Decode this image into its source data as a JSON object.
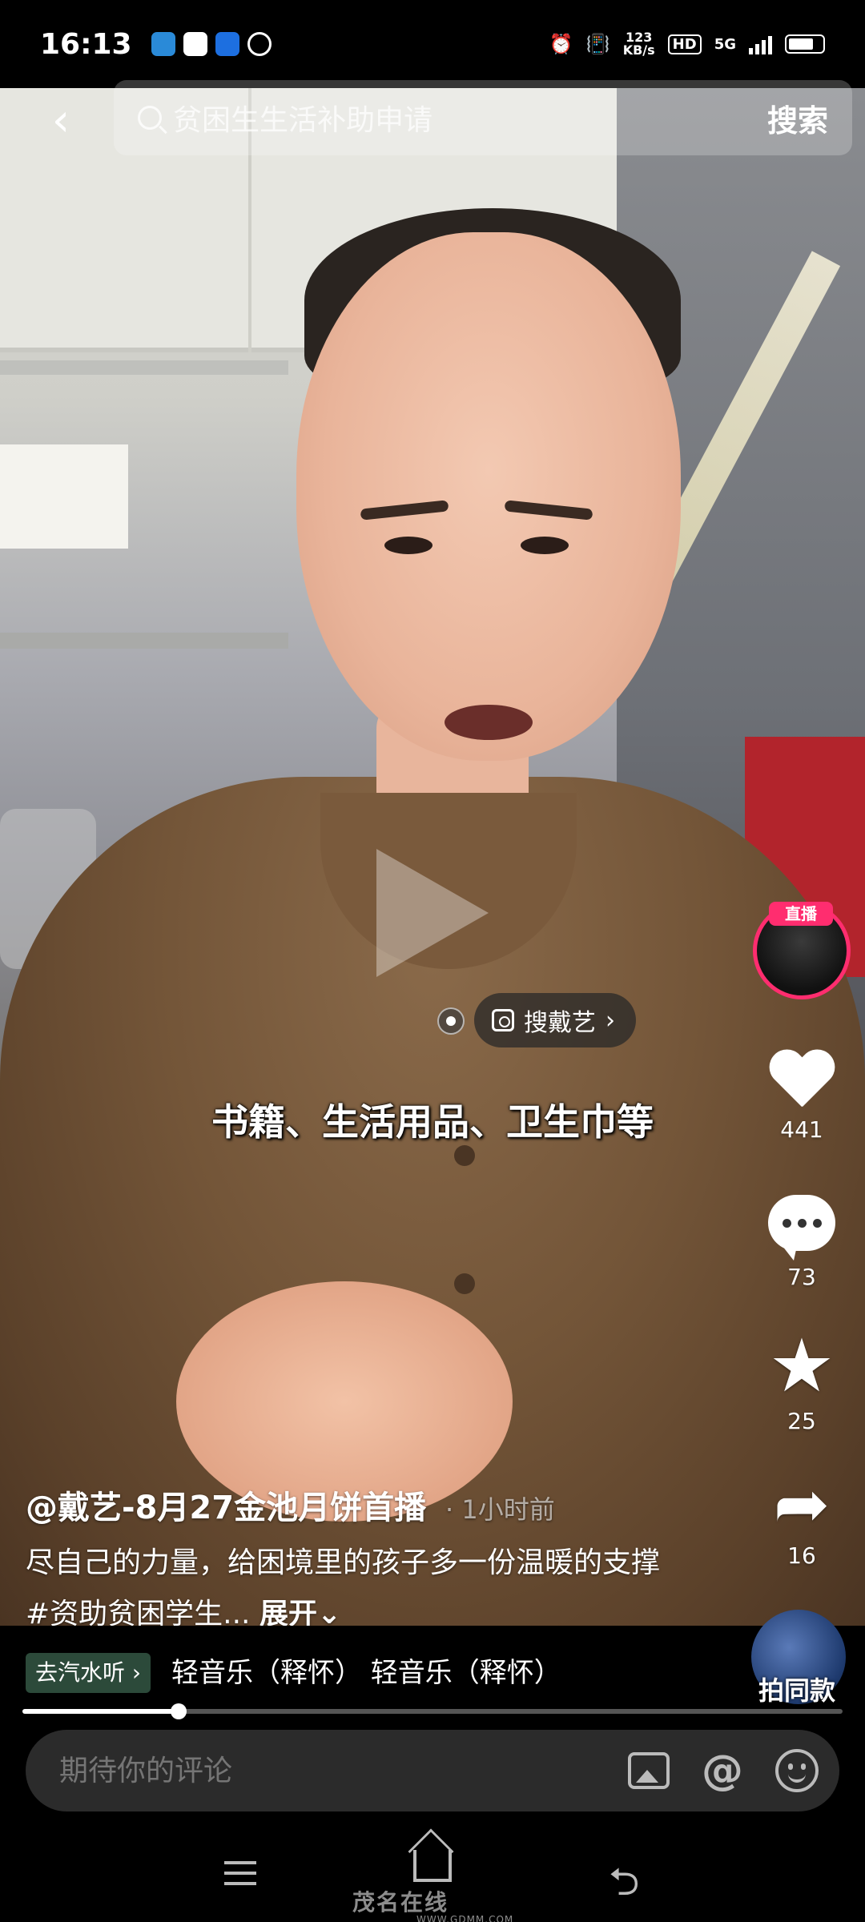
{
  "status_bar": {
    "time": "16:13",
    "net_speed_value": "123",
    "net_speed_unit": "KB/s",
    "hd": "HD",
    "network": "5G"
  },
  "search": {
    "query": "贫困生生活补助申请",
    "button_label": "搜索"
  },
  "video": {
    "subtitle": "书籍、生活用品、卫生巾等",
    "search_chip": "搜戴艺"
  },
  "rail": {
    "live_badge": "直播",
    "likes": "441",
    "comments": "73",
    "favorites": "25",
    "shares": "16"
  },
  "post": {
    "author": "@戴艺-8月27金池月饼首播",
    "time": "· 1小时前",
    "description": "尽自己的力量，给困境里的孩子多一份温暖的支撑 #资助贫困学生...",
    "expand_label": "展开⌄"
  },
  "music": {
    "tag": "去汽水听 ›",
    "title": "轻音乐（释怀）    轻音乐（释怀）",
    "same_style_label": "拍同款"
  },
  "progress": {
    "played_fraction": 0.19
  },
  "comment": {
    "placeholder": "期待你的评论"
  },
  "nav": {
    "watermark": "茂名在线",
    "watermark_url": "WWW.GDMM.COM"
  },
  "colors": {
    "live_ring": "#ff2d6f",
    "music_tag_bg": "#2c4a3a"
  }
}
